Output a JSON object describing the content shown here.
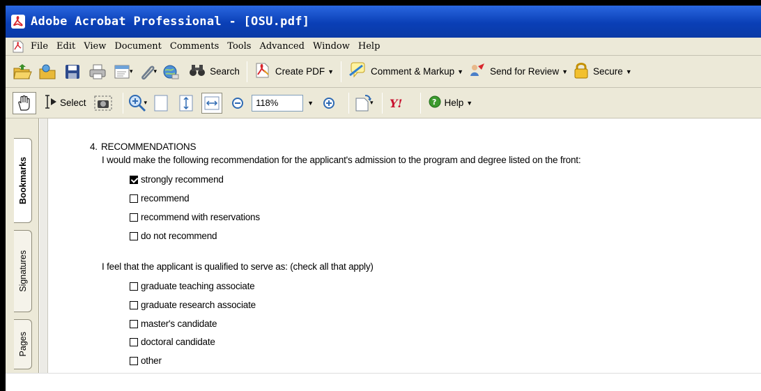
{
  "window": {
    "title": "Adobe Acrobat Professional  -  [OSU.pdf]"
  },
  "menu": [
    "File",
    "Edit",
    "View",
    "Document",
    "Comments",
    "Tools",
    "Advanced",
    "Window",
    "Help"
  ],
  "toolbar1": {
    "search_label": "Search",
    "create_pdf_label": "Create PDF",
    "comment_markup_label": "Comment & Markup",
    "send_review_label": "Send for Review",
    "secure_label": "Secure"
  },
  "toolbar2": {
    "select_label": "Select",
    "zoom_value": "118%",
    "help_label": "Help"
  },
  "sidebar": {
    "tabs": [
      "Bookmarks",
      "Signatures",
      "Pages"
    ]
  },
  "document": {
    "section_number": "4.",
    "section_title": "RECOMMENDATIONS",
    "intro": "I would make the following recommendation for the applicant's admission to the program and degree listed on the front:",
    "recommendations": [
      {
        "label": "strongly recommend",
        "checked": true
      },
      {
        "label": "recommend",
        "checked": false
      },
      {
        "label": "recommend with reservations",
        "checked": false
      },
      {
        "label": "do not recommend",
        "checked": false
      }
    ],
    "qualified_intro": "I feel that the applicant is qualified to serve as: (check all that apply)",
    "roles": [
      {
        "label": "graduate teaching associate",
        "checked": false
      },
      {
        "label": "graduate research associate",
        "checked": false
      },
      {
        "label": "master's candidate",
        "checked": false
      },
      {
        "label": "doctoral candidate",
        "checked": false
      },
      {
        "label": "other",
        "checked": false
      }
    ]
  },
  "colors": {
    "titlebar": "#0a3fb6",
    "toolbar": "#ece9d8",
    "acrobat_red": "#d8262c"
  }
}
